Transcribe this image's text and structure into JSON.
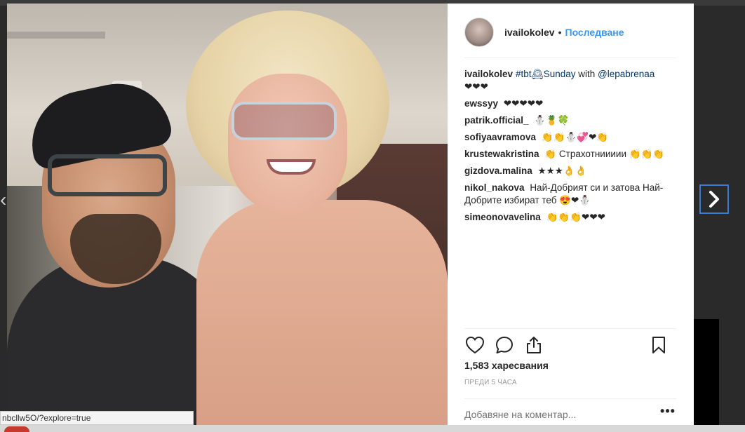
{
  "post": {
    "username": "ivailokolev",
    "dot": "•",
    "follow_label": "Последване",
    "likes_text": "1,583 харесвания",
    "time_text": "ПРЕДИ 5 ЧАСА",
    "comment_placeholder": "Добавяне на коментар...",
    "more_label": "•••"
  },
  "caption": {
    "user": "ivailokolev",
    "hashtag": "#tbt🕰Sunday",
    "with": "with",
    "mention": "@lepabrenaa",
    "hearts": "❤❤❤"
  },
  "comments": [
    {
      "user": "ewssyy",
      "text": "❤❤❤❤❤"
    },
    {
      "user": "patrik.official_",
      "text": "⛄🍍🍀"
    },
    {
      "user": "sofiyaavramova",
      "text": "👏👏⛄💞❤👏"
    },
    {
      "user": "krustewakristina",
      "text": "👏 Страхотниииии 👏👏👏"
    },
    {
      "user": "gizdova.malina",
      "text": "★★★👌👌"
    },
    {
      "user": "nikol_nakova",
      "text": "Най-Добрият си и затова Най-Добрите избират теб 😍❤⛄"
    },
    {
      "user": "simeonovavelina",
      "text": "👏👏👏❤❤❤"
    }
  ],
  "status_url": "nbcllw5O/?explore=true",
  "icons": {
    "like": "heart-icon",
    "comment": "comment-icon",
    "share": "share-icon",
    "save": "bookmark-icon",
    "next": "chevron-right-icon",
    "prev": "chevron-left-icon"
  },
  "colors": {
    "follow": "#3897f0",
    "mention": "#003569",
    "text": "#262626",
    "muted": "#999999",
    "nav_border": "#3b7bd6"
  }
}
